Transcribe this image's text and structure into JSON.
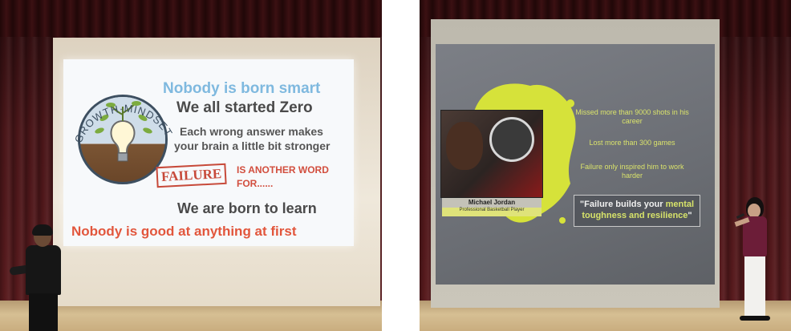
{
  "left_photo": {
    "slide": {
      "logo_text": "GROWTH·MINDSET",
      "line1": "Nobody is born smart",
      "line2": "We all started Zero",
      "line3": "Each wrong answer makes",
      "line4": "your brain a little bit stronger",
      "failure_stamp": "FAILURE",
      "another_word": "IS ANOTHER WORD",
      "for": "FOR......",
      "born_to_learn": "We are born to learn",
      "good_at_first": "Nobody is good at anything at first"
    }
  },
  "right_photo": {
    "slide": {
      "caption_name": "Michael Jordan",
      "caption_title": "Professional Basketball Player",
      "fact1": "Missed more than 9000 shots in his career",
      "fact2": "Lost more than 300 games",
      "fact3": "Failure only inspired him to work harder",
      "quote_part1": "\"Failure builds your ",
      "quote_emphasis": "mental toughness and resilience",
      "quote_end": "\""
    }
  },
  "colors": {
    "curtain": "#4a1619",
    "stage_floor": "#d6bf93",
    "accent_blue": "#7fb9df",
    "accent_red": "#e2563c",
    "accent_yellow": "#d7e36a"
  }
}
